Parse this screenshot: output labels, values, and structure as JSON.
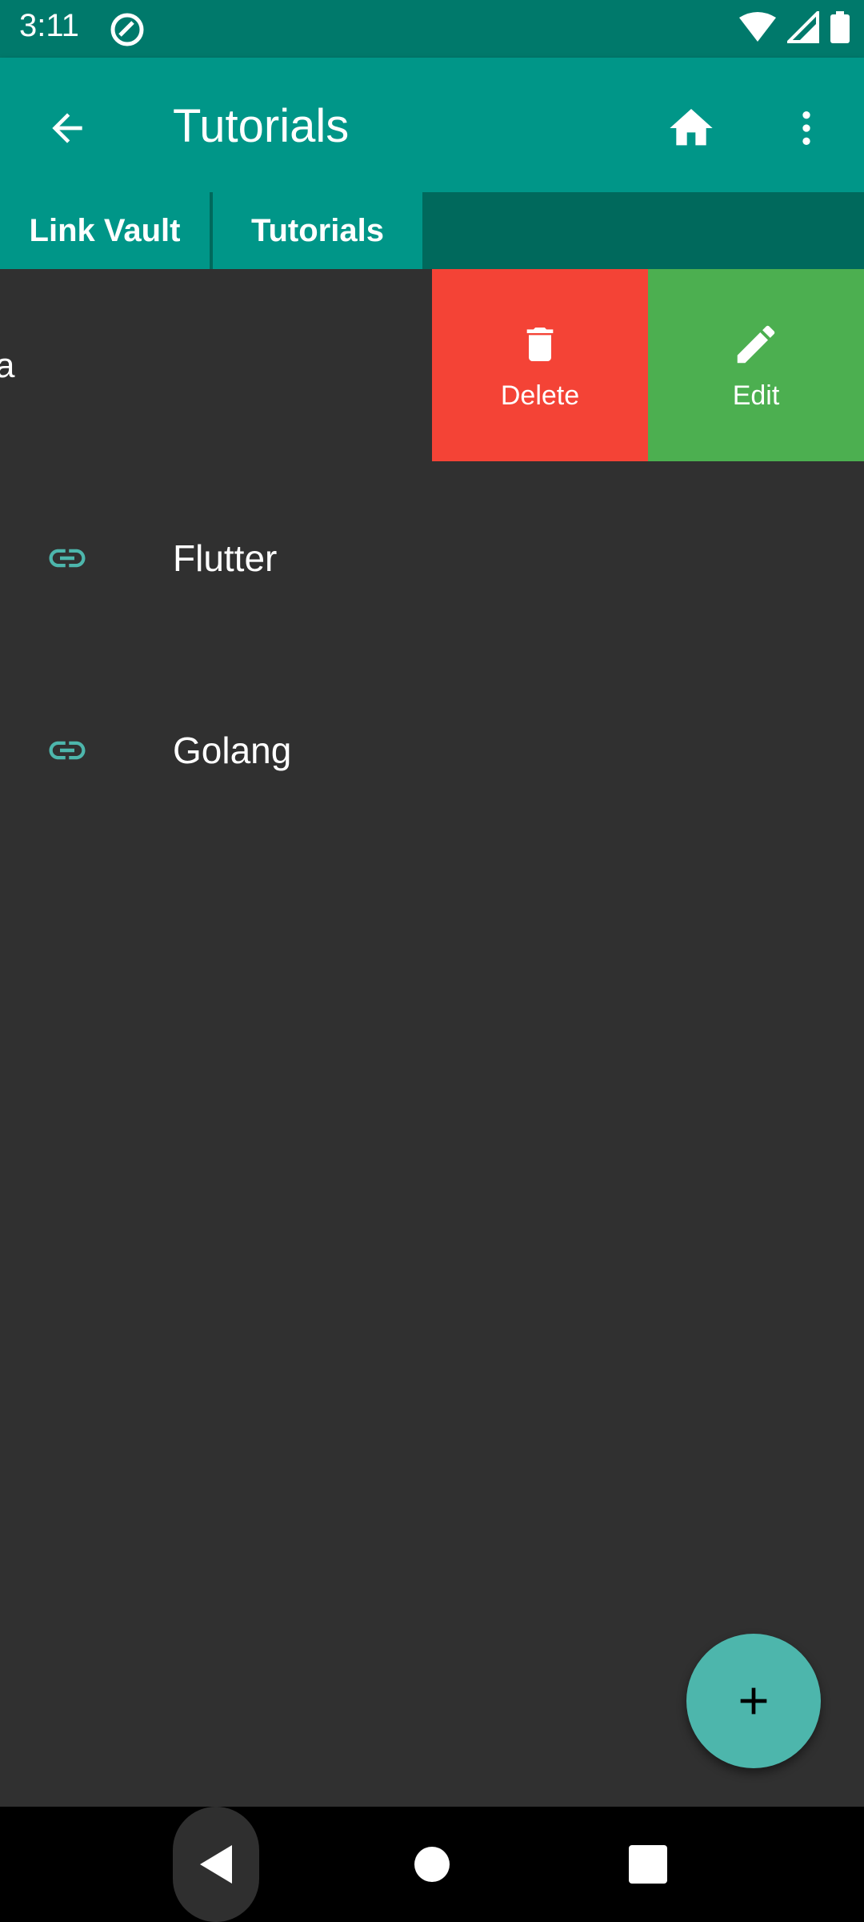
{
  "status_bar": {
    "time": "3:11"
  },
  "app_bar": {
    "title": "Tutorials"
  },
  "breadcrumbs": [
    {
      "label": "Link Vault"
    },
    {
      "label": "Tutorials"
    }
  ],
  "list": {
    "swiped_item": {
      "visible_text": "a",
      "actions": [
        {
          "label": "Delete",
          "icon": "trash-icon",
          "color": "#f44336"
        },
        {
          "label": "Edit",
          "icon": "pencil-icon",
          "color": "#4caf50"
        }
      ]
    },
    "items": [
      {
        "label": "Flutter",
        "icon": "link-icon"
      },
      {
        "label": "Golang",
        "icon": "link-icon"
      }
    ]
  },
  "colors": {
    "primary": "#009688",
    "primary_dark": "#00796b",
    "accent": "#4db6ac",
    "background": "#303030"
  }
}
